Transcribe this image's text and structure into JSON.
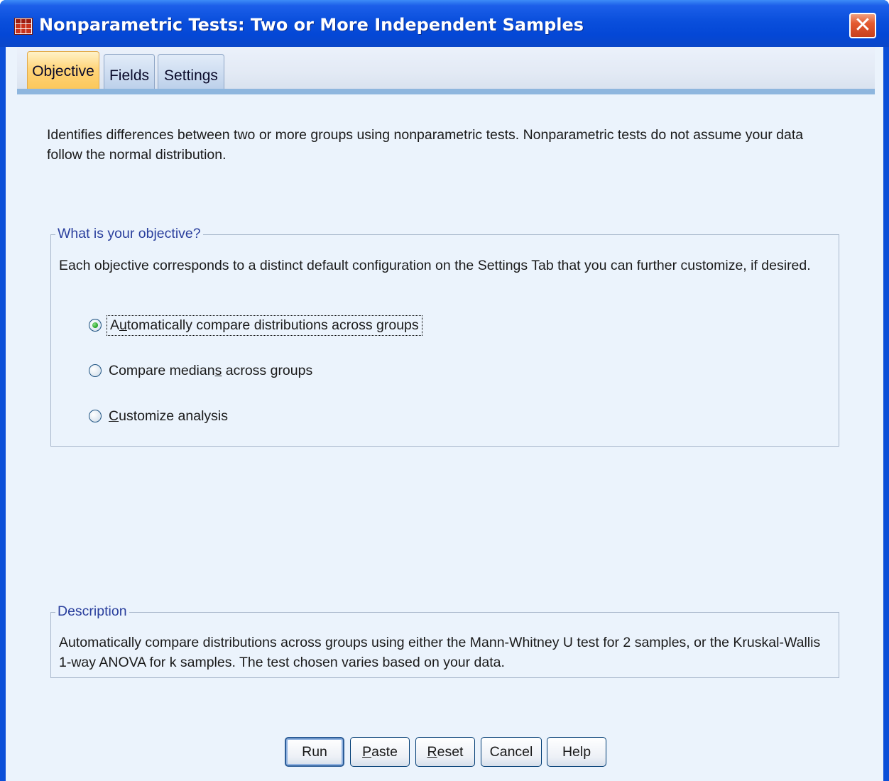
{
  "window": {
    "title": "Nonparametric Tests: Two or More Independent Samples",
    "close_label": "✕"
  },
  "tabs": [
    {
      "label": "Objective",
      "active": true
    },
    {
      "label": "Fields",
      "active": false
    },
    {
      "label": "Settings",
      "active": false
    }
  ],
  "intro_text": "Identifies differences between two or more groups using nonparametric tests. Nonparametric tests do not assume your data follow the normal distribution.",
  "objective_group": {
    "legend": "What is your objective?",
    "text": "Each objective corresponds to a distinct default configuration on the Settings Tab that you can further customize, if desired.",
    "options": [
      {
        "pre": "A",
        "u": "u",
        "post": "tomatically compare distributions across groups",
        "selected": true
      },
      {
        "pre": "Compare median",
        "u": "s",
        "post": " across groups",
        "selected": false
      },
      {
        "pre": "",
        "u": "C",
        "post": "ustomize analysis",
        "selected": false
      }
    ]
  },
  "description_group": {
    "legend": "Description",
    "text": "Automatically compare distributions across groups using either the Mann-Whitney U test for 2 samples, or the Kruskal-Wallis 1-way ANOVA for k samples.  The test chosen varies based on your data."
  },
  "buttons": {
    "run": "Run",
    "paste_u": "P",
    "paste_rest": "aste",
    "reset_u": "R",
    "reset_rest": "eset",
    "cancel": "Cancel",
    "help": "Help"
  },
  "colors": {
    "titlebar": "#0a4fdc",
    "client_bg": "#ebf3fc",
    "active_tab": "#ffd57a",
    "legend_text": "#2a3f9d"
  }
}
